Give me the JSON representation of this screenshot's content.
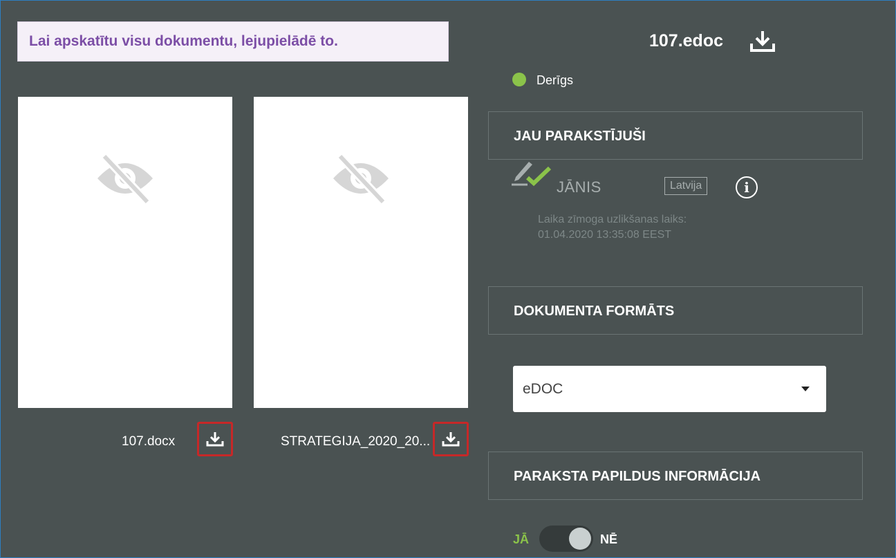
{
  "notice": {
    "text": "Lai apskatītu visu dokumentu, lejupielādē to."
  },
  "documents": [
    {
      "name": "107.docx",
      "preview": "hidden-preview"
    },
    {
      "name": "STRATEGIJA_2020_20...",
      "preview": "hidden-preview"
    }
  ],
  "container": {
    "title": "107.edoc",
    "icon": "download-icon"
  },
  "status": {
    "text": "Derīgs",
    "color": "#8bc34a"
  },
  "signed": {
    "heading": "JAU PARAKSTĪJUŠI",
    "signer": {
      "name": "JĀNIS",
      "country": "Latvija",
      "timestamp_label": "Laika zīmoga uzlikšanas laiks:",
      "timestamp": "01.04.2020 13:35:08 EEST"
    }
  },
  "format": {
    "heading": "DOKUMENTA FORMĀTS",
    "selected": "eDOC"
  },
  "additional_info": {
    "heading": "PARAKSTA PAPILDUS INFORMĀCIJA",
    "toggle_yes": "JĀ",
    "toggle_no": "NĒ",
    "toggle_state": "NĒ"
  },
  "colors": {
    "panel": "#4a5252",
    "accent_green": "#8bc34a",
    "notice_text": "#7c4ea6",
    "highlight_red": "#c62828"
  }
}
